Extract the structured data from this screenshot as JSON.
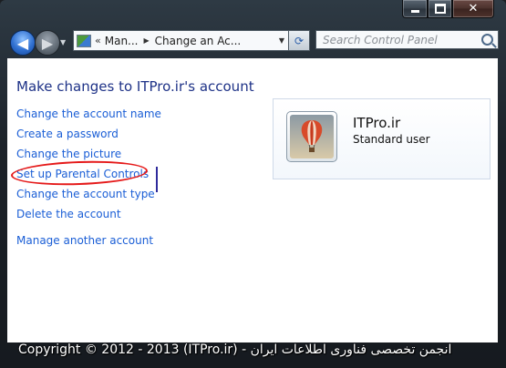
{
  "window": {
    "caption": {
      "minimize_icon": "minimize-icon",
      "maximize_icon": "maximize-icon",
      "close_icon": "close-icon",
      "close_glyph": "✕"
    }
  },
  "nav": {
    "back_glyph": "◀",
    "forward_glyph": "▶",
    "address": {
      "chevron": "«",
      "segments": [
        "Man...",
        "Change an Ac..."
      ],
      "separator": "▶"
    },
    "refresh_glyph": "⟳",
    "search_placeholder": "Search Control Panel"
  },
  "page": {
    "title": "Make changes to ITPro.ir's account",
    "links": [
      "Change the account name",
      "Create a password",
      "Change the picture",
      "Set up Parental Controls",
      "Change the account type",
      "Delete the account"
    ],
    "extra_link": "Manage another account"
  },
  "user": {
    "name": "ITPro.ir",
    "role": "Standard user",
    "avatar_icon": "hot-air-balloon-icon"
  },
  "footer": {
    "text": "Copyright © 2012 - 2013 (ITPro.ir) - انجمن تخصصی فناوری اطلاعات ایران"
  },
  "colors": {
    "link": "#1a5ed6",
    "title": "#1e3287",
    "highlight": "#e51a1a"
  }
}
